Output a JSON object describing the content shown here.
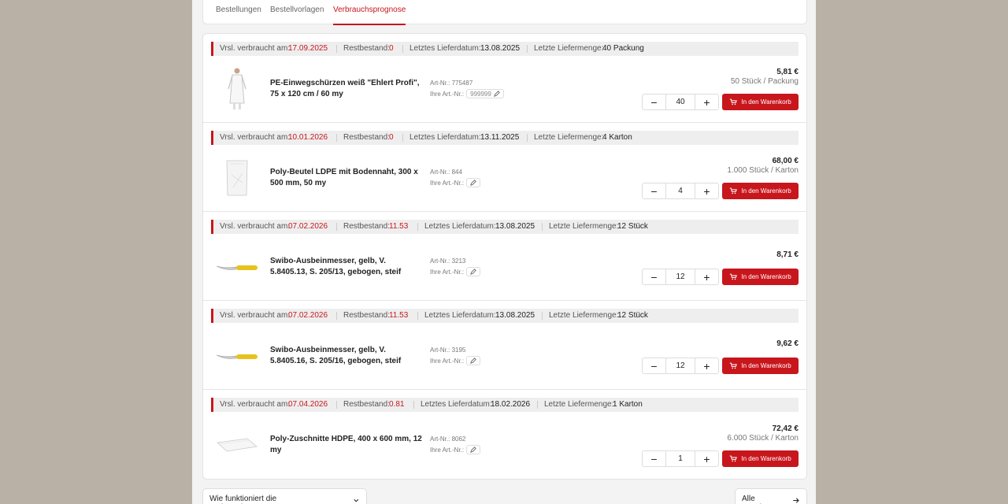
{
  "tabs": [
    {
      "label": "Bestellungen"
    },
    {
      "label": "Bestellvorlagen"
    },
    {
      "label": "Verbrauchsprognose"
    }
  ],
  "labels": {
    "consumed": "Vrsl. verbraucht am:",
    "stock": "Restbestand:",
    "last_date": "Letztes Lieferdatum:",
    "last_qty": "Letzte Liefermenge:",
    "art_nr": "Art-Nr.:",
    "own_art_nr": "Ihre Art.-Nr.:",
    "cart": "In den Warenkorb"
  },
  "items": [
    {
      "consumed": "17.09.2025",
      "stock": "0",
      "last_date": "13.08.2025",
      "last_qty": "40 Packung",
      "name": "PE-Einwegschürzen weiß \"Ehlert Profi\", 75 x 120 cm / 60 my",
      "art_nr": "775487",
      "own_art_nr": "999999",
      "price": "5,81 €",
      "unit": "50 Stück / Packung",
      "qty": "40",
      "image": "apron"
    },
    {
      "consumed": "10.01.2026",
      "stock": "0",
      "last_date": "13.11.2025",
      "last_qty": "4 Karton",
      "name": "Poly-Beutel LDPE mit Bodennaht, 300 x 500 mm, 50 my",
      "art_nr": "844",
      "own_art_nr": "",
      "price": "68,00 €",
      "unit": "1.000 Stück / Karton",
      "qty": "4",
      "image": "bag"
    },
    {
      "consumed": "07.02.2026",
      "stock": "11.53",
      "last_date": "13.08.2025",
      "last_qty": "12 Stück",
      "name": "Swibo-Ausbeinmesser, gelb, V. 5.8405.13, S. 205/13, gebogen, steif",
      "art_nr": "3213",
      "own_art_nr": "",
      "price": "8,71 €",
      "unit": "",
      "qty": "12",
      "image": "knife"
    },
    {
      "consumed": "07.02.2026",
      "stock": "11.53",
      "last_date": "13.08.2025",
      "last_qty": "12 Stück",
      "name": "Swibo-Ausbeinmesser, gelb, V. 5.8405.16, S. 205/16, gebogen, steif",
      "art_nr": "3195",
      "own_art_nr": "",
      "price": "9,62 €",
      "unit": "",
      "qty": "12",
      "image": "knife"
    },
    {
      "consumed": "07.04.2026",
      "stock": "0.81",
      "last_date": "18.02.2026",
      "last_qty": "1 Karton",
      "name": "Poly-Zuschnitte HDPE, 400 x 600 mm, 12 my",
      "art_nr": "8062",
      "own_art_nr": "",
      "price": "72,42 €",
      "unit": "6.000 Stück / Karton",
      "qty": "1",
      "image": "sheet"
    }
  ],
  "footer": {
    "help": "Wie funktioniert die Verbrauchsprognose?",
    "all": "Alle Anzeigen"
  },
  "colors": {
    "accent": "#c8161d",
    "background": "#b9b0a6"
  }
}
